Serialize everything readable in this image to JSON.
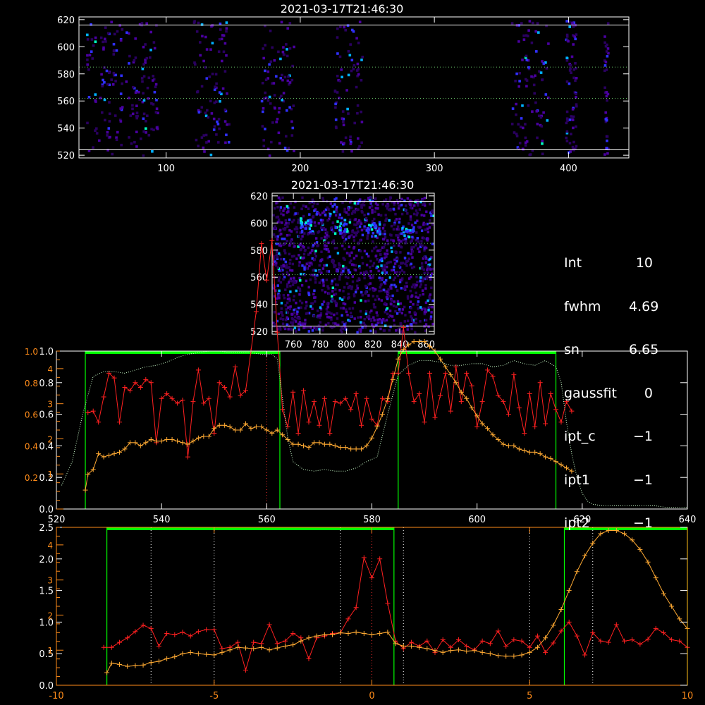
{
  "panels": {
    "top": {
      "title": "2021-03-17T21:46:30"
    },
    "zoom": {
      "title": "2021-03-17T21:46:30"
    }
  },
  "params": [
    {
      "key": "Int",
      "value": "10"
    },
    {
      "key": "fwhm",
      "value": "4.69"
    },
    {
      "key": "sn",
      "value": "6.65"
    },
    {
      "key": "gaussfit",
      "value": "0"
    },
    {
      "key": "ipt_c",
      "value": "−1"
    },
    {
      "key": "ipt1",
      "value": "−1"
    },
    {
      "key": "ipt2",
      "value": "−1"
    }
  ],
  "colors": {
    "axis_white": "#ffffff",
    "axis_orange": "#ff8c1a",
    "window_green": "#00ff00",
    "red_series": "#ff2020",
    "orange_series": "#ffaa33",
    "dotted_series": "#ccffcc",
    "spectrogram_palette": [
      "#2a0060",
      "#4a00a0",
      "#3030ff",
      "#00b0ff",
      "#00ffc0"
    ]
  },
  "chart_data": [
    {
      "id": "spectrogram-top",
      "type": "heatmap",
      "title": "2021-03-17T21:46:30",
      "xlim": [
        35,
        445
      ],
      "ylim": [
        518,
        622
      ],
      "xticks": [
        100,
        200,
        300,
        400
      ],
      "yticks": [
        520,
        540,
        560,
        580,
        600,
        620
      ],
      "hlines": [
        524,
        562,
        585,
        616
      ],
      "bands": [
        [
          40,
          95
        ],
        [
          120,
          148
        ],
        [
          170,
          197
        ],
        [
          225,
          248
        ],
        [
          357,
          386
        ],
        [
          397,
          407
        ],
        [
          426,
          431
        ]
      ]
    },
    {
      "id": "spectrogram-zoom",
      "type": "heatmap",
      "title": "2021-03-17T21:46:30",
      "xlim": [
        744,
        866
      ],
      "ylim": [
        518,
        622
      ],
      "xticks": [
        760,
        780,
        800,
        820,
        840,
        860
      ],
      "yticks": [
        520,
        540,
        560,
        580,
        600,
        620
      ],
      "hlines": [
        524,
        562,
        585,
        616
      ]
    },
    {
      "id": "spectrum-wavelength",
      "type": "line",
      "xlim": [
        520,
        640
      ],
      "xticks": [
        520,
        540,
        560,
        580,
        600,
        620,
        640
      ],
      "ylim_left": [
        0,
        1.0
      ],
      "yticks_left_white": [
        "0.0",
        "0.2",
        "0.4",
        "0.6",
        "0.8",
        "1.0"
      ],
      "ylim_right_orange": [
        0,
        4.5
      ],
      "yticks_right_orange": [
        "1",
        "2",
        "3",
        "4"
      ],
      "yticks_left_orange_extra": [
        "1.0",
        "0.8",
        "0.6",
        "0.4",
        "0.2"
      ],
      "green_windows": [
        [
          525.5,
          562.5
        ],
        [
          585,
          615
        ]
      ],
      "red_vline": 560,
      "series": [
        {
          "color": "red",
          "x": [
            526,
            527,
            528,
            529,
            530,
            531,
            532,
            533,
            534,
            535,
            536,
            537,
            538,
            539,
            540,
            541,
            542,
            543,
            544,
            545,
            546,
            547,
            548,
            549,
            550,
            551,
            552,
            553,
            554,
            555,
            556,
            557,
            558,
            559,
            560,
            561,
            562,
            563,
            564,
            565,
            566,
            567,
            568,
            569,
            570,
            571,
            572,
            573,
            574,
            575,
            576,
            577,
            578,
            579,
            580,
            581,
            582,
            583,
            584,
            585,
            586,
            587,
            588,
            589,
            590,
            591,
            592,
            593,
            594,
            595,
            596,
            597,
            598,
            599,
            600,
            601,
            602,
            603,
            604,
            605,
            606,
            607,
            608,
            609,
            610,
            611,
            612,
            613,
            614,
            615,
            616,
            617,
            618
          ],
          "values": [
            0.61,
            0.62,
            0.55,
            0.71,
            0.86,
            0.83,
            0.55,
            0.77,
            0.75,
            0.8,
            0.77,
            0.82,
            0.8,
            0.42,
            0.7,
            0.73,
            0.7,
            0.67,
            0.69,
            0.33,
            0.68,
            0.88,
            0.67,
            0.7,
            0.48,
            0.8,
            0.77,
            0.71,
            0.9,
            0.72,
            0.75,
            1.0,
            1.25,
            1.68,
            1.45,
            1.7,
            1.12,
            0.63,
            0.52,
            0.74,
            0.48,
            0.75,
            0.55,
            0.68,
            0.53,
            0.7,
            0.48,
            0.68,
            0.67,
            0.7,
            0.63,
            0.73,
            0.53,
            0.7,
            0.57,
            0.53,
            0.7,
            0.68,
            0.86,
            0.86,
            1.15,
            0.86,
            0.68,
            0.73,
            0.55,
            0.86,
            0.58,
            0.72,
            0.86,
            0.62,
            0.9,
            0.68,
            0.86,
            0.78,
            0.52,
            0.68,
            0.88,
            0.84,
            0.72,
            0.68,
            0.6,
            0.85,
            0.64,
            0.48,
            0.73,
            0.52,
            0.8,
            0.54,
            0.73,
            0.63,
            0.55,
            0.68,
            0.62
          ]
        },
        {
          "color": "orange",
          "x": [
            525.5,
            526,
            527,
            528,
            529,
            530,
            531,
            532,
            533,
            534,
            535,
            536,
            537,
            538,
            539,
            540,
            541,
            542,
            543,
            544,
            545,
            546,
            547,
            548,
            549,
            550,
            551,
            552,
            553,
            554,
            555,
            556,
            557,
            558,
            559,
            560,
            561,
            562,
            563,
            564,
            565,
            566,
            567,
            568,
            569,
            570,
            571,
            572,
            573,
            574,
            575,
            576,
            577,
            578,
            579,
            580,
            581,
            582,
            583,
            584,
            585,
            586,
            587,
            588,
            589,
            590,
            591,
            592,
            593,
            594,
            595,
            596,
            597,
            598,
            599,
            600,
            601,
            602,
            603,
            604,
            605,
            606,
            607,
            608,
            609,
            610,
            611,
            612,
            613,
            614,
            615,
            616,
            617,
            618
          ],
          "values": [
            0.12,
            0.22,
            0.25,
            0.35,
            0.33,
            0.34,
            0.35,
            0.36,
            0.38,
            0.42,
            0.42,
            0.4,
            0.42,
            0.44,
            0.43,
            0.43,
            0.44,
            0.44,
            0.43,
            0.42,
            0.41,
            0.43,
            0.45,
            0.46,
            0.46,
            0.51,
            0.53,
            0.53,
            0.52,
            0.5,
            0.5,
            0.54,
            0.51,
            0.52,
            0.52,
            0.5,
            0.48,
            0.5,
            0.47,
            0.44,
            0.41,
            0.41,
            0.4,
            0.39,
            0.42,
            0.42,
            0.41,
            0.41,
            0.4,
            0.39,
            0.39,
            0.38,
            0.38,
            0.38,
            0.4,
            0.45,
            0.52,
            0.6,
            0.7,
            0.82,
            0.95,
            1.01,
            1.04,
            1.06,
            1.06,
            1.06,
            1.03,
            1.0,
            0.95,
            0.9,
            0.85,
            0.8,
            0.74,
            0.7,
            0.64,
            0.59,
            0.54,
            0.51,
            0.47,
            0.44,
            0.41,
            0.4,
            0.4,
            0.38,
            0.37,
            0.36,
            0.36,
            0.35,
            0.33,
            0.32,
            0.3,
            0.28,
            0.26,
            0.24
          ]
        },
        {
          "color": "dotted-green",
          "x": [
            521,
            523,
            525,
            527,
            529,
            531,
            533,
            535,
            537,
            539,
            541,
            543,
            545,
            547,
            549,
            551,
            553,
            555,
            557,
            559,
            561,
            562,
            563,
            564,
            565,
            567,
            569,
            571,
            573,
            575,
            577,
            579,
            581,
            583,
            585,
            587,
            589,
            591,
            593,
            595,
            597,
            599,
            601,
            603,
            605,
            607,
            609,
            611,
            613,
            614,
            615,
            616,
            617,
            618,
            619,
            620,
            621,
            622,
            624,
            626,
            628,
            630,
            632,
            634,
            636,
            638,
            640
          ],
          "values": [
            0.15,
            0.3,
            0.6,
            0.84,
            0.87,
            0.87,
            0.86,
            0.88,
            0.9,
            0.91,
            0.93,
            0.96,
            0.98,
            0.99,
            1.0,
            1.0,
            0.99,
            0.99,
            0.99,
            0.98,
            0.98,
            0.95,
            0.7,
            0.45,
            0.3,
            0.25,
            0.24,
            0.25,
            0.24,
            0.24,
            0.26,
            0.3,
            0.33,
            0.6,
            0.85,
            0.91,
            0.94,
            0.94,
            0.93,
            0.91,
            0.91,
            0.92,
            0.92,
            0.9,
            0.91,
            0.94,
            0.92,
            0.91,
            0.94,
            0.92,
            0.9,
            0.8,
            0.55,
            0.35,
            0.2,
            0.1,
            0.05,
            0.03,
            0.02,
            0.02,
            0.02,
            0.02,
            0.02,
            0.02,
            0.01,
            0.01,
            0.01
          ]
        }
      ]
    },
    {
      "id": "spectrum-velocity",
      "type": "line",
      "xlim": [
        -10,
        10
      ],
      "xticks": [
        -10,
        -5,
        0,
        5,
        10
      ],
      "ylim_left": [
        0,
        2.5
      ],
      "yticks_left_white": [
        "0.0",
        "0.5",
        "1.0",
        "1.5",
        "2.0",
        "2.5"
      ],
      "ylim_right_orange": [
        0,
        4.5
      ],
      "yticks_right_orange": [
        "1",
        "2",
        "3",
        "4"
      ],
      "green_windows": [
        [
          -8.4,
          0.7
        ],
        [
          6.1,
          10
        ]
      ],
      "dotted_vlines": [
        -7,
        -5,
        -1,
        1,
        5,
        7
      ],
      "red_vline": 0,
      "series": [
        {
          "color": "red",
          "x": [
            -8.5,
            -8.25,
            -8.0,
            -7.75,
            -7.5,
            -7.25,
            -7.0,
            -6.75,
            -6.5,
            -6.25,
            -6.0,
            -5.75,
            -5.5,
            -5.25,
            -5.0,
            -4.75,
            -4.5,
            -4.25,
            -4.0,
            -3.75,
            -3.5,
            -3.25,
            -3.0,
            -2.75,
            -2.5,
            -2.25,
            -2.0,
            -1.75,
            -1.5,
            -1.25,
            -1.0,
            -0.75,
            -0.5,
            -0.25,
            0.0,
            0.25,
            0.5,
            0.75,
            1.0,
            1.25,
            1.5,
            1.75,
            2.0,
            2.25,
            2.5,
            2.75,
            3.0,
            3.25,
            3.5,
            3.75,
            4.0,
            4.25,
            4.5,
            4.75,
            5.0,
            5.25,
            5.5,
            5.75,
            6.0,
            6.25,
            6.5,
            6.75,
            7.0,
            7.25,
            7.5,
            7.75,
            8.0,
            8.25,
            8.5,
            8.75,
            9.0,
            9.25,
            9.5,
            9.75,
            10.0
          ],
          "values": [
            0.6,
            0.6,
            0.68,
            0.75,
            0.85,
            0.95,
            0.9,
            0.62,
            0.82,
            0.8,
            0.84,
            0.78,
            0.85,
            0.88,
            0.88,
            0.58,
            0.6,
            0.68,
            0.24,
            0.68,
            0.66,
            0.96,
            0.66,
            0.7,
            0.82,
            0.75,
            0.42,
            0.75,
            0.78,
            0.82,
            0.83,
            1.05,
            1.23,
            2.02,
            1.7,
            2.0,
            1.3,
            0.7,
            0.58,
            0.68,
            0.62,
            0.7,
            0.52,
            0.72,
            0.6,
            0.72,
            0.62,
            0.56,
            0.7,
            0.66,
            0.86,
            0.62,
            0.72,
            0.7,
            0.6,
            0.78,
            0.52,
            0.67,
            0.86,
            1.0,
            0.78,
            0.48,
            0.83,
            0.7,
            0.68,
            0.96,
            0.7,
            0.72,
            0.65,
            0.73,
            0.9,
            0.83,
            0.72,
            0.7,
            0.6
          ]
        },
        {
          "color": "orange",
          "x": [
            -8.4,
            -8.25,
            -8.0,
            -7.75,
            -7.5,
            -7.25,
            -7.0,
            -6.75,
            -6.5,
            -6.25,
            -6.0,
            -5.75,
            -5.5,
            -5.25,
            -5.0,
            -4.75,
            -4.5,
            -4.25,
            -4.0,
            -3.75,
            -3.5,
            -3.25,
            -3.0,
            -2.75,
            -2.5,
            -2.25,
            -2.0,
            -1.75,
            -1.5,
            -1.25,
            -1.0,
            -0.75,
            -0.5,
            -0.25,
            0.0,
            0.25,
            0.5,
            0.75,
            1.0,
            1.25,
            1.5,
            1.75,
            2.0,
            2.25,
            2.5,
            2.75,
            3.0,
            3.25,
            3.5,
            3.75,
            4.0,
            4.25,
            4.5,
            4.75,
            5.0,
            5.25,
            5.5,
            5.75,
            6.0,
            6.25,
            6.5,
            6.75,
            7.0,
            7.25,
            7.5,
            7.75,
            8.0,
            8.25,
            8.5,
            8.75,
            9.0,
            9.25,
            9.5,
            9.75,
            10.0
          ],
          "values": [
            0.2,
            0.35,
            0.33,
            0.3,
            0.31,
            0.32,
            0.36,
            0.38,
            0.42,
            0.45,
            0.5,
            0.52,
            0.5,
            0.49,
            0.48,
            0.52,
            0.56,
            0.6,
            0.59,
            0.58,
            0.6,
            0.56,
            0.59,
            0.62,
            0.64,
            0.7,
            0.75,
            0.78,
            0.8,
            0.8,
            0.83,
            0.82,
            0.84,
            0.82,
            0.8,
            0.82,
            0.84,
            0.66,
            0.62,
            0.62,
            0.6,
            0.58,
            0.55,
            0.52,
            0.55,
            0.56,
            0.54,
            0.55,
            0.52,
            0.5,
            0.47,
            0.46,
            0.46,
            0.48,
            0.52,
            0.6,
            0.75,
            0.95,
            1.2,
            1.5,
            1.8,
            2.05,
            2.25,
            2.4,
            2.45,
            2.45,
            2.4,
            2.3,
            2.15,
            1.95,
            1.7,
            1.45,
            1.25,
            1.05,
            0.9
          ]
        }
      ]
    }
  ]
}
